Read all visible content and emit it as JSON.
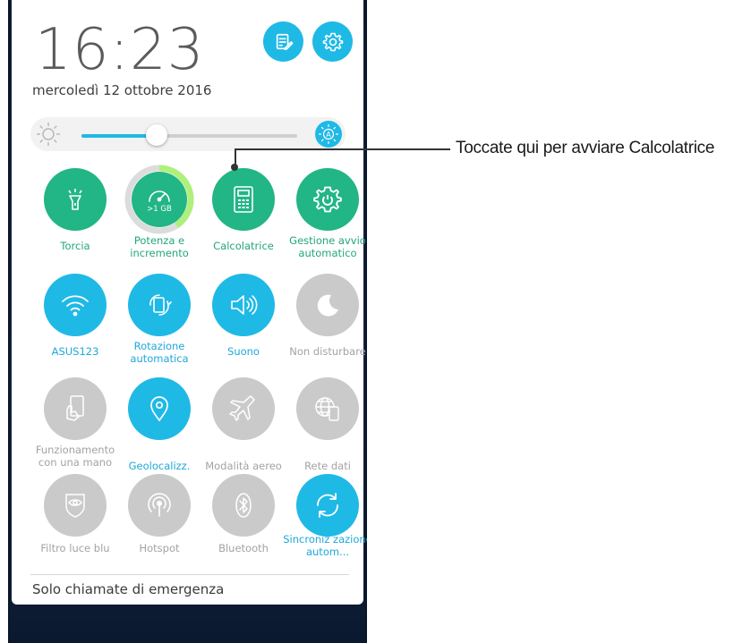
{
  "status": {
    "time": "16:23",
    "date": "mercoledì 12 ottobre 2016"
  },
  "header_buttons": {
    "notes_icon": "notes-edit-icon",
    "settings_icon": "gear-icon"
  },
  "brightness": {
    "level": 0.35,
    "low_icon": "sun-low-icon",
    "auto_icon": "auto-brightness-icon",
    "auto_badge": "A"
  },
  "tiles": [
    {
      "label": "Torcia",
      "state": "on",
      "color": "#22b585",
      "icon": "flashlight-icon"
    },
    {
      "label": "Potenza e incremento",
      "state": "on",
      "color": "#22b585",
      "icon": "speedometer-icon",
      "badge": ">1 GB"
    },
    {
      "label": "Calcolatrice",
      "state": "on",
      "color": "#22b585",
      "icon": "calculator-icon"
    },
    {
      "label": "Gestione avvio automatico",
      "state": "on",
      "color": "#22b585",
      "icon": "gear-power-icon"
    },
    {
      "label": "ASUS123",
      "state": "on",
      "color": "#1fb9e6",
      "icon": "wifi-icon"
    },
    {
      "label": "Rotazione automatica",
      "state": "on",
      "color": "#1fb9e6",
      "icon": "rotate-icon"
    },
    {
      "label": "Suono",
      "state": "on",
      "color": "#1fb9e6",
      "icon": "speaker-icon"
    },
    {
      "label": "Non disturbare",
      "state": "off",
      "color": "#cacaca",
      "icon": "moon-icon"
    },
    {
      "label": "Funzionamento con una mano",
      "state": "off",
      "color": "#cacaca",
      "icon": "one-hand-icon"
    },
    {
      "label": "Geolocalizz.",
      "state": "on",
      "color": "#1fb9e6",
      "icon": "location-pin-icon"
    },
    {
      "label": "Modalità aereo",
      "state": "off",
      "color": "#cacaca",
      "icon": "airplane-icon"
    },
    {
      "label": "Rete dati",
      "state": "off",
      "color": "#cacaca",
      "icon": "globe-phone-icon"
    },
    {
      "label": "Filtro luce blu",
      "state": "off",
      "color": "#cacaca",
      "icon": "eye-shield-icon"
    },
    {
      "label": "Hotspot",
      "state": "off",
      "color": "#cacaca",
      "icon": "hotspot-icon"
    },
    {
      "label": "Bluetooth",
      "state": "off",
      "color": "#cacaca",
      "icon": "bluetooth-icon"
    },
    {
      "label": "Sincroniz zazione autom...",
      "state": "on",
      "color": "#1fb9e6",
      "icon": "sync-icon"
    }
  ],
  "footer": {
    "emergency_text": "Solo chiamate di emergenza"
  },
  "callout": {
    "text": "Toccate qui per avviare Calcolatrice"
  }
}
